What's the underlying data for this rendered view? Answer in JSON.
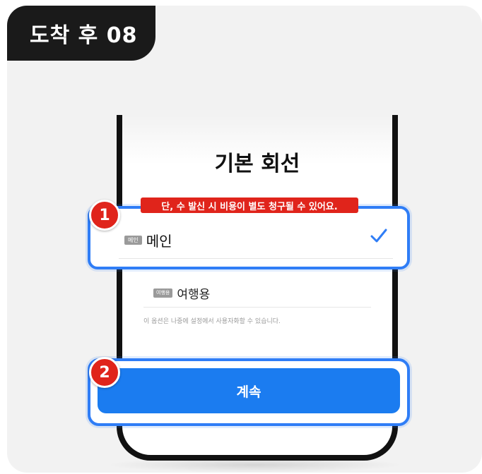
{
  "step_badge": "도착 후 08",
  "screen": {
    "title": "기본 회선",
    "warning": "단, 수 발신 시 비용이 별도 청구될 수 있어요.",
    "options": [
      {
        "tag": "메인",
        "label": "메인",
        "selected": true
      },
      {
        "tag": "여행용",
        "label": "여행용",
        "selected": false
      }
    ],
    "hint": "이 옵션은 나중에 설정에서 사용자화할 수 있습니다.",
    "continue_label": "계속"
  },
  "callouts": [
    "1",
    "2"
  ],
  "colors": {
    "accent": "#2f7df6",
    "button": "#1b7cf0",
    "warning": "#e0241b",
    "badge": "#1a1a1a"
  },
  "icons": {
    "check": "checkmark-icon"
  }
}
